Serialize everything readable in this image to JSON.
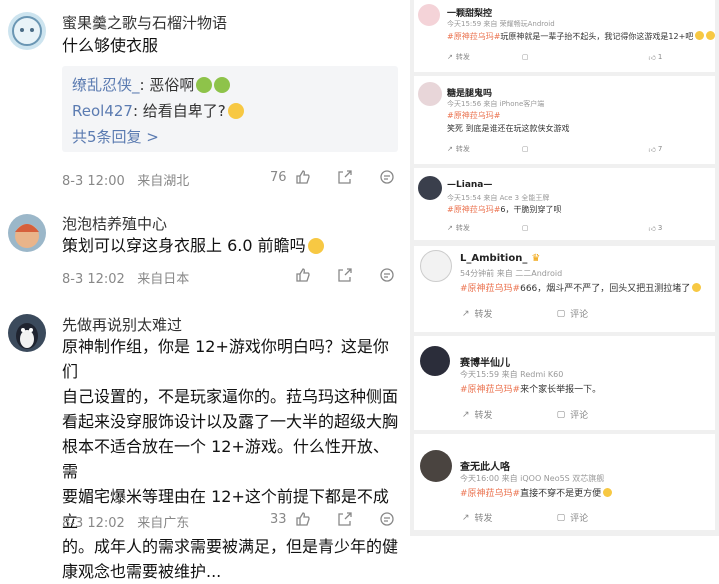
{
  "left_comments": [
    {
      "user": "蜜果羹之歌与石榴汁物语",
      "text": "什么够使衣服",
      "replies": [
        {
          "name": "缭乱忍侠_",
          "sep": ": ",
          "text": "恶俗啊"
        },
        {
          "name": "Reol427",
          "sep": ": ",
          "text": "给看自卑了?"
        }
      ],
      "more": "共5条回复 >",
      "date": "8-3 12:00",
      "location": "来自湖北",
      "likes": "76"
    },
    {
      "user": "泡泡桔养殖中心",
      "text": "策划可以穿这身衣服上 6.0 前瞻吗",
      "date": "8-3 12:02",
      "location": "来自日本",
      "likes": ""
    },
    {
      "user": "先做再说别太难过",
      "lines": [
        "原神制作组，你是 12+游戏你明白吗？这是你们",
        "自己设置的，不是玩家逼你的。菈乌玛这种侧面",
        "看起来没穿服饰设计以及露了一大半的超级大胸",
        "根本不适合放在一个 12+游戏。什么性开放、需",
        "要媚宅爆米等理由在 12+这个前提下都是不成立",
        "的。成年人的需求需要被满足，但是青少年的健",
        "康观念也需要被维护..."
      ],
      "date": "8-3 12:02",
      "location": "来自广东",
      "likes": "33"
    }
  ],
  "right_cards": [
    {
      "name": "一颗甜梨控",
      "meta": "今天15:59 来自 荣耀畅玩Android",
      "tag": "#原神菈乌玛#",
      "text": "玩原神就是一辈子抬不起头，我记得你这游戏是12+吧",
      "repost": "转发",
      "comment": "",
      "likes": "1"
    },
    {
      "name": "糖是腿鬼吗",
      "meta": "今天15:56 来自 iPhone客户端",
      "tag": "#原神菈乌玛#",
      "text2": "笑死 到底是谁还在玩这款侠女游戏",
      "repost": "转发",
      "comment": "",
      "likes": "7"
    },
    {
      "name": "—Liana—",
      "meta": "今天15:54 来自 Ace 3 全能王牌",
      "tag": "#原神菈乌玛#",
      "text": "6，干脆别穿了呗",
      "repost": "转发",
      "comment": "",
      "likes": "3"
    },
    {
      "name": "L_Ambition_",
      "meta": "54分钟前 来自 二二Android",
      "tag": "#原神菈乌玛#",
      "text": "666，烟斗严不严了，回头又把丑测拉堵了",
      "repost": "转发",
      "comment": "评论"
    },
    {
      "name": "赛博半仙儿",
      "meta": "今天15:59 来自 Redmi K60",
      "tag": "#原神菈乌玛#",
      "text": "来个家长举报一下。",
      "repost": "转发",
      "comment": "评论"
    },
    {
      "name": "查无此人咯",
      "meta": "今天16:00 来自 iQOO Neo5S 双芯旗舰",
      "tag": "#原神菈乌玛#",
      "text": "直接不穿不是更方便",
      "repost": "转发",
      "comment": "评论"
    }
  ]
}
